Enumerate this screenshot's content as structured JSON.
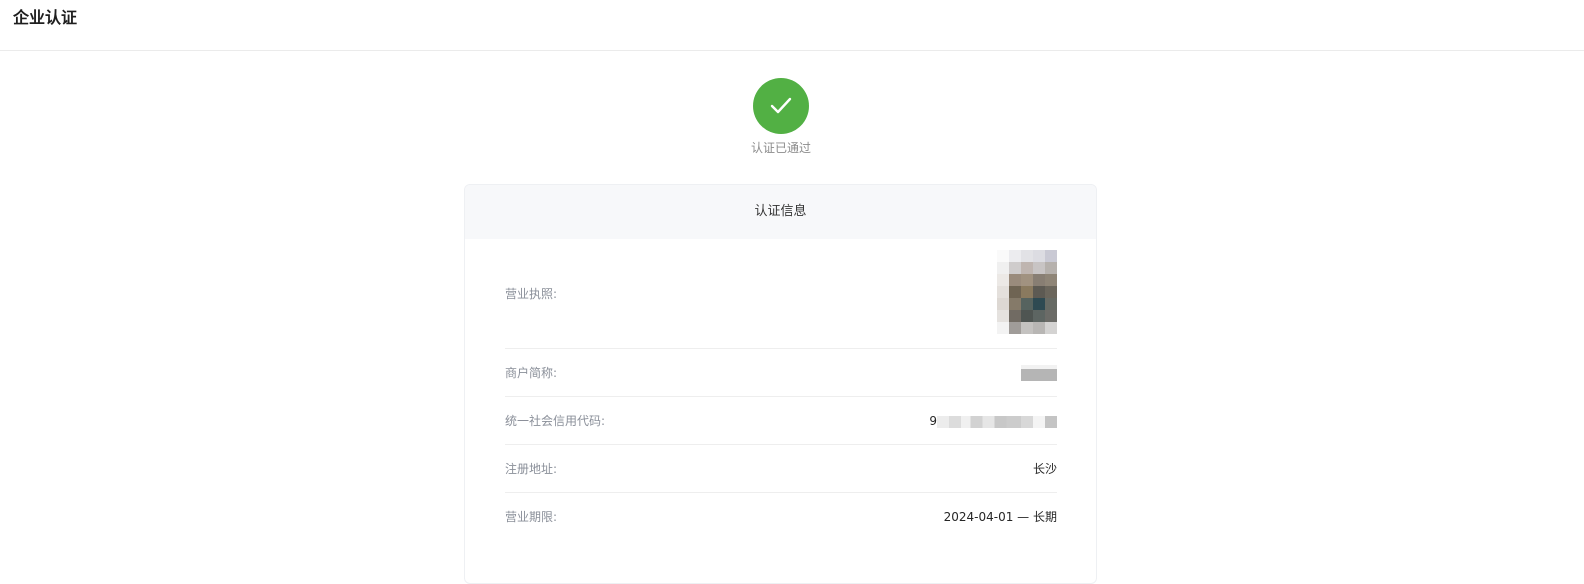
{
  "header": {
    "title": "企业认证"
  },
  "status": {
    "icon": "check-icon",
    "text": "认证已通过",
    "color": "#52b044"
  },
  "card": {
    "title": "认证信息",
    "rows": [
      {
        "label": "营业执照:",
        "value": ""
      },
      {
        "label": "商户简称:",
        "value": ""
      },
      {
        "label": "统一社会信用代码:",
        "value": "9"
      },
      {
        "label": "注册地址:",
        "value": "长沙"
      },
      {
        "label": "营业期限:",
        "value": "2024-04-01 — 长期"
      }
    ]
  }
}
